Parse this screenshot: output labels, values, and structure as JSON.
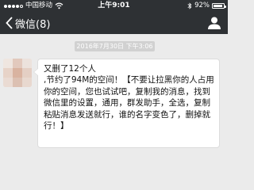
{
  "status_bar": {
    "carrier": "中国移动",
    "time": "上午9:01",
    "battery_percent": "92%",
    "battery_level": 0.92,
    "icons": [
      "signal-icon",
      "wifi-icon",
      "bluetooth-icon",
      "battery-icon"
    ]
  },
  "nav": {
    "back_label": "微信(8)",
    "back_icon": "chevron-left-icon",
    "contact_icon": "person-icon"
  },
  "chat": {
    "timestamp": "2016年7月30日 下午3:06",
    "sender_avatar": "avatar-blurred",
    "message_text": "又删了12个人\n,节约了94M的空间！【不要让拉黑你的人占用你的空间，您也试试吧，复制我的消息，找到微信里的设置，通用，群发助手，全选，复制粘贴消息发送就行，谁的名字变色了，删掉就行！】"
  },
  "colors": {
    "top_bar": "#2e3134",
    "chat_background": "#ebebeb",
    "bubble": "#ffffff",
    "timestamp_pill": "#d1d1d1"
  }
}
